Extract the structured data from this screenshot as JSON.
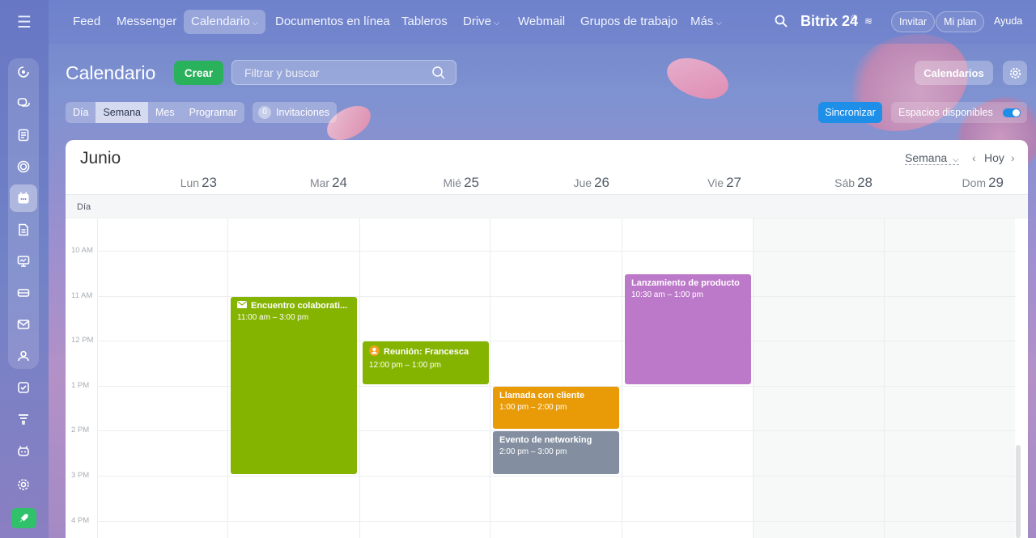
{
  "nav": {
    "items": [
      {
        "label": "Feed",
        "dropdown": false,
        "active": false
      },
      {
        "label": "Messenger",
        "dropdown": false,
        "active": false
      },
      {
        "label": "Calendario",
        "dropdown": true,
        "active": true
      },
      {
        "label": "Documentos en línea",
        "dropdown": false,
        "active": false
      },
      {
        "label": "Tableros",
        "dropdown": false,
        "active": false
      },
      {
        "label": "Drive",
        "dropdown": true,
        "active": false
      },
      {
        "label": "Webmail",
        "dropdown": false,
        "active": false
      },
      {
        "label": "Grupos de trabajo",
        "dropdown": false,
        "active": false
      },
      {
        "label": "Más",
        "dropdown": true,
        "active": false
      }
    ],
    "brand": "Bitrix 24",
    "invite": "Invitar",
    "plan": "Mi plan",
    "help": "Ayuda"
  },
  "header": {
    "title": "Calendario",
    "create_label": "Crear",
    "search_placeholder": "Filtrar y buscar",
    "calendars_label": "Calendarios"
  },
  "views": {
    "options": [
      "Día",
      "Semana",
      "Mes",
      "Programar"
    ],
    "active": "Semana",
    "invitations_count": "0",
    "invitations_label": "Invitaciones",
    "sync_label": "Sincronizar",
    "available_label": "Espacios disponibles"
  },
  "calendar": {
    "month": "Junio",
    "view_selector": "Semana",
    "today_label": "Hoy",
    "allday_label": "Día",
    "days": [
      {
        "name": "Lun",
        "date": "23"
      },
      {
        "name": "Mar",
        "date": "24"
      },
      {
        "name": "Mié",
        "date": "25"
      },
      {
        "name": "Jue",
        "date": "26"
      },
      {
        "name": "Vie",
        "date": "27"
      },
      {
        "name": "Sáb",
        "date": "28"
      },
      {
        "name": "Dom",
        "date": "29"
      }
    ],
    "hours": [
      "10 AM",
      "11 AM",
      "12 PM",
      "1 PM",
      "2 PM",
      "3 PM",
      "4 PM"
    ],
    "events": [
      {
        "title": "Encuentro colaborati...",
        "time": "11:00 am – 3:00 pm",
        "day": 1,
        "start": 11,
        "end": 15,
        "color": "#85b400",
        "icon": "envelope-icon"
      },
      {
        "title": "Reunión: Francesca",
        "time": "12:00 pm – 1:00 pm",
        "day": 2,
        "start": 12,
        "end": 13,
        "color": "#85b400",
        "icon": "person-icon"
      },
      {
        "title": "Llamada con cliente",
        "time": "1:00 pm – 2:00 pm",
        "day": 3,
        "start": 13,
        "end": 14,
        "color": "#e89b06",
        "icon": ""
      },
      {
        "title": "Evento de networking",
        "time": "2:00 pm – 3:00 pm",
        "day": 3,
        "start": 14,
        "end": 15,
        "color": "#838fa0",
        "icon": ""
      },
      {
        "title": "Lanzamiento de producto",
        "time": "10:30 am – 1:00 pm",
        "day": 4,
        "start": 10.5,
        "end": 13,
        "color": "#bd79c9",
        "icon": ""
      }
    ]
  },
  "colors": {
    "create": "#2ab15b",
    "sync": "#1e8fe8"
  }
}
